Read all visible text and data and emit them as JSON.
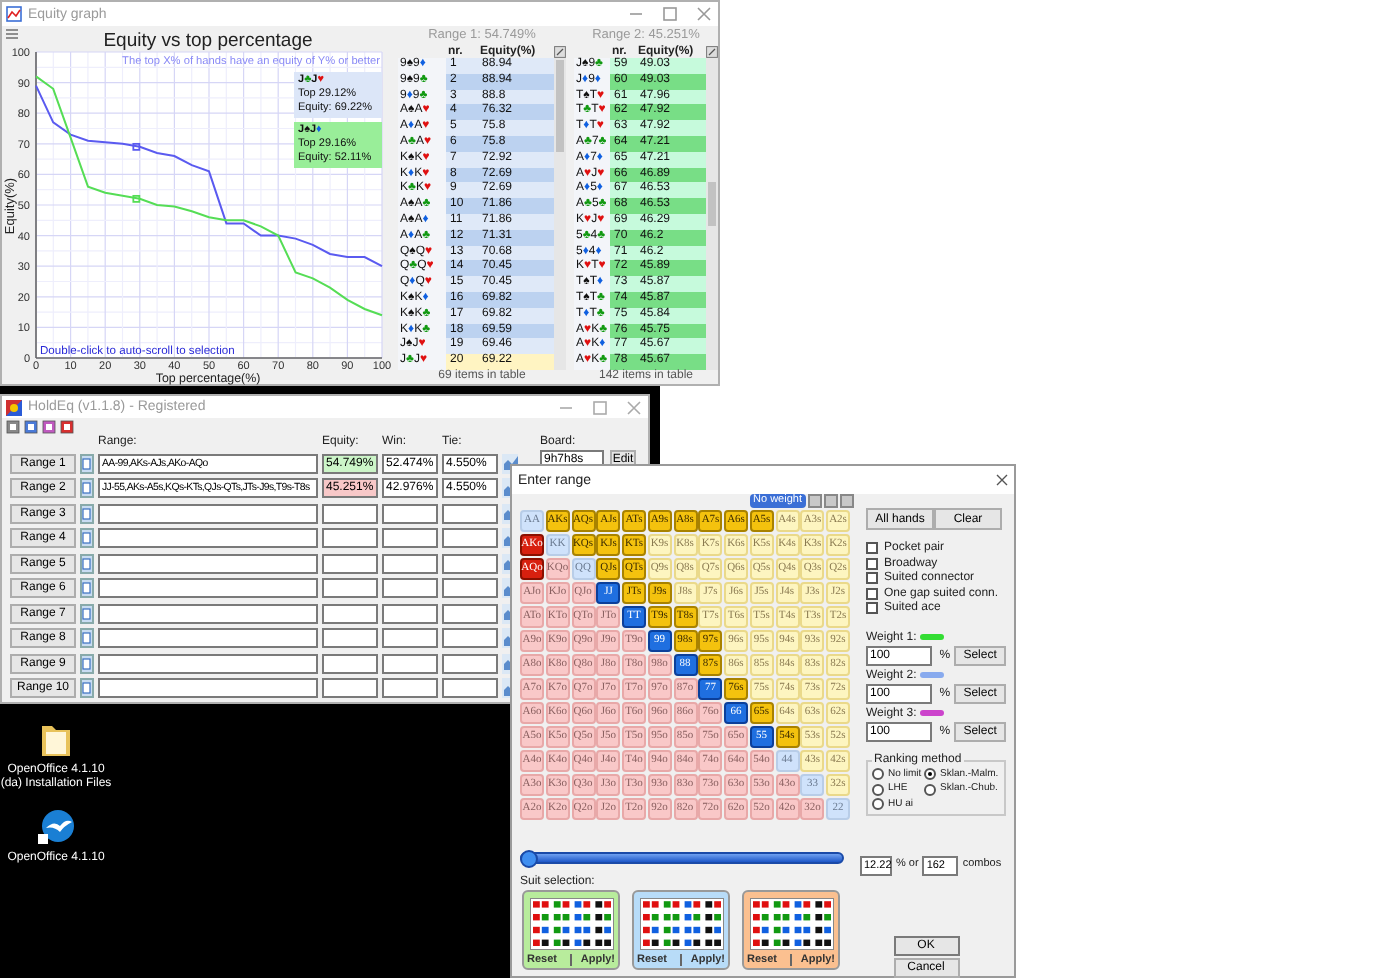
{
  "equity_graph": {
    "title": "Equity graph",
    "subtitle": "The top X% of hands have an equity of Y% or better",
    "hint": "Double-click to auto-scroll to selection",
    "chart_data": {
      "type": "line",
      "title": "Equity vs top percentage",
      "xlabel": "Top percentage(%)",
      "ylabel": "Equity(%)",
      "x": [
        0,
        5,
        10,
        15,
        20,
        25,
        30,
        35,
        40,
        45,
        50,
        55,
        60,
        65,
        70,
        75,
        80,
        85,
        90,
        95,
        100
      ],
      "grid": true,
      "series": [
        {
          "color": "#5a5af0",
          "values": [
            89,
            77,
            73,
            71,
            70.5,
            70,
            69,
            67,
            66,
            63,
            61,
            44,
            44,
            40,
            40,
            39,
            37,
            34,
            33,
            33,
            30
          ]
        },
        {
          "color": "#55dd55",
          "values": [
            92,
            88,
            72,
            56,
            54,
            53,
            52,
            50,
            49.5,
            48,
            46,
            45,
            45,
            43,
            40,
            28,
            26,
            23,
            19,
            16,
            14
          ]
        }
      ],
      "xlim": [
        0,
        100
      ],
      "ylim": [
        0,
        100
      ],
      "xticks": [
        0,
        10,
        20,
        30,
        40,
        50,
        60,
        70,
        80,
        90,
        100
      ],
      "yticks": [
        0,
        10,
        20,
        30,
        40,
        50,
        60,
        70,
        80,
        90,
        100
      ]
    },
    "highlights": [
      {
        "hand": "J♣J♥",
        "top": "Top 29.12%",
        "equity": "Equity: 69.22%",
        "color": "#dce6f8"
      },
      {
        "hand": "J♠J♦",
        "top": "Top 29.16%",
        "equity": "Equity: 52.11%",
        "color": "#99ee99"
      }
    ],
    "tables": [
      {
        "title": "Range 1: 54.749%",
        "columns": [
          "nr.",
          "Equity(%)"
        ],
        "footer": "69 items in table",
        "rows": [
          {
            "hand": "9♠9♦",
            "nr": "1",
            "equity": "88.94",
            "selected": false
          },
          {
            "hand": "9♠9♣",
            "nr": "2",
            "equity": "88.94",
            "selected": false
          },
          {
            "hand": "9♦9♣",
            "nr": "3",
            "equity": "88.8",
            "selected": false
          },
          {
            "hand": "A♠A♥",
            "nr": "4",
            "equity": "76.32",
            "selected": false
          },
          {
            "hand": "A♦A♥",
            "nr": "5",
            "equity": "75.8",
            "selected": false
          },
          {
            "hand": "A♣A♥",
            "nr": "6",
            "equity": "75.8",
            "selected": false
          },
          {
            "hand": "K♠K♥",
            "nr": "7",
            "equity": "72.92",
            "selected": false
          },
          {
            "hand": "K♦K♥",
            "nr": "8",
            "equity": "72.69",
            "selected": false
          },
          {
            "hand": "K♣K♥",
            "nr": "9",
            "equity": "72.69",
            "selected": false
          },
          {
            "hand": "A♠A♣",
            "nr": "10",
            "equity": "71.86",
            "selected": false
          },
          {
            "hand": "A♠A♦",
            "nr": "11",
            "equity": "71.86",
            "selected": false
          },
          {
            "hand": "A♦A♣",
            "nr": "12",
            "equity": "71.31",
            "selected": false
          },
          {
            "hand": "Q♠Q♥",
            "nr": "13",
            "equity": "70.68",
            "selected": false
          },
          {
            "hand": "Q♣Q♥",
            "nr": "14",
            "equity": "70.45",
            "selected": false
          },
          {
            "hand": "Q♦Q♥",
            "nr": "15",
            "equity": "70.45",
            "selected": false
          },
          {
            "hand": "K♠K♦",
            "nr": "16",
            "equity": "69.82",
            "selected": false
          },
          {
            "hand": "K♠K♣",
            "nr": "17",
            "equity": "69.82",
            "selected": false
          },
          {
            "hand": "K♦K♣",
            "nr": "18",
            "equity": "69.59",
            "selected": false
          },
          {
            "hand": "J♠J♥",
            "nr": "19",
            "equity": "69.46",
            "selected": false
          },
          {
            "hand": "J♣J♥",
            "nr": "20",
            "equity": "69.22",
            "selected": true
          }
        ]
      },
      {
        "title": "Range 2: 45.251%",
        "columns": [
          "nr.",
          "Equity(%)"
        ],
        "footer": "142 items in table",
        "rows": [
          {
            "hand": "J♠9♣",
            "nr": "59",
            "equity": "49.03",
            "selected": false
          },
          {
            "hand": "J♦9♦",
            "nr": "60",
            "equity": "49.03",
            "selected": false
          },
          {
            "hand": "T♠T♥",
            "nr": "61",
            "equity": "47.96",
            "selected": false
          },
          {
            "hand": "T♣T♥",
            "nr": "62",
            "equity": "47.92",
            "selected": false
          },
          {
            "hand": "T♦T♥",
            "nr": "63",
            "equity": "47.92",
            "selected": false
          },
          {
            "hand": "A♣7♣",
            "nr": "64",
            "equity": "47.21",
            "selected": false
          },
          {
            "hand": "A♦7♦",
            "nr": "65",
            "equity": "47.21",
            "selected": false
          },
          {
            "hand": "A♥J♥",
            "nr": "66",
            "equity": "46.89",
            "selected": false
          },
          {
            "hand": "A♦5♦",
            "nr": "67",
            "equity": "46.53",
            "selected": false
          },
          {
            "hand": "A♣5♣",
            "nr": "68",
            "equity": "46.53",
            "selected": false
          },
          {
            "hand": "K♥J♥",
            "nr": "69",
            "equity": "46.29",
            "selected": false
          },
          {
            "hand": "5♣4♣",
            "nr": "70",
            "equity": "46.2",
            "selected": false
          },
          {
            "hand": "5♦4♦",
            "nr": "71",
            "equity": "46.2",
            "selected": false
          },
          {
            "hand": "K♥T♥",
            "nr": "72",
            "equity": "45.89",
            "selected": false
          },
          {
            "hand": "T♠T♦",
            "nr": "73",
            "equity": "45.87",
            "selected": false
          },
          {
            "hand": "T♠T♣",
            "nr": "74",
            "equity": "45.87",
            "selected": false
          },
          {
            "hand": "T♦T♣",
            "nr": "75",
            "equity": "45.84",
            "selected": false
          },
          {
            "hand": "A♥K♣",
            "nr": "76",
            "equity": "45.75",
            "selected": false
          },
          {
            "hand": "A♥K♦",
            "nr": "77",
            "equity": "45.67",
            "selected": false
          },
          {
            "hand": "A♥K♣",
            "nr": "78",
            "equity": "45.67",
            "selected": false
          }
        ]
      }
    ]
  },
  "holdeq": {
    "title": "HoldEq (v1.1.8) - Registered",
    "columns": [
      "Range:",
      "Equity:",
      "Win:",
      "Tie:"
    ],
    "board_label": "Board:",
    "board": "9h7h8s",
    "edit": "Edit",
    "ranges": [
      {
        "label": "Range 1",
        "range": "AA-99,AKs-AJs,AKo-AQo",
        "equity": "54.749%",
        "win": "52.474%",
        "tie": "4.550%",
        "color": "#ccf5c8"
      },
      {
        "label": "Range 2",
        "range": "JJ-55,AKs-A5s,KQs-KTs,QJs-QTs,JTs-J9s,T9s-T8s",
        "equity": "45.251%",
        "win": "42.976%",
        "tie": "4.550%",
        "color": "#f8c8c8"
      },
      {
        "label": "Range 3"
      },
      {
        "label": "Range 4"
      },
      {
        "label": "Range 5"
      },
      {
        "label": "Range 6"
      },
      {
        "label": "Range 7"
      },
      {
        "label": "Range 8"
      },
      {
        "label": "Range 9"
      },
      {
        "label": "Range 10"
      }
    ]
  },
  "enter_range": {
    "title": "Enter range",
    "weight_badge": "No weight",
    "hand_grid": [
      [
        {
          "label": "AA",
          "selected": false
        },
        {
          "label": "AKs",
          "selected": true
        },
        {
          "label": "AQs",
          "selected": true
        },
        {
          "label": "AJs",
          "selected": true
        },
        {
          "label": "ATs",
          "selected": true
        },
        {
          "label": "A9s",
          "selected": true
        },
        {
          "label": "A8s",
          "selected": true
        },
        {
          "label": "A7s",
          "selected": true
        },
        {
          "label": "A6s",
          "selected": true
        },
        {
          "label": "A5s",
          "selected": true
        },
        {
          "label": "A4s",
          "selected": false
        },
        {
          "label": "A3s",
          "selected": false
        },
        {
          "label": "A2s",
          "selected": false
        }
      ],
      [
        {
          "label": "AKo",
          "selected": true
        },
        {
          "label": "KK",
          "selected": false
        },
        {
          "label": "KQs",
          "selected": true
        },
        {
          "label": "KJs",
          "selected": true
        },
        {
          "label": "KTs",
          "selected": true
        },
        {
          "label": "K9s",
          "selected": false
        },
        {
          "label": "K8s",
          "selected": false
        },
        {
          "label": "K7s",
          "selected": false
        },
        {
          "label": "K6s",
          "selected": false
        },
        {
          "label": "K5s",
          "selected": false
        },
        {
          "label": "K4s",
          "selected": false
        },
        {
          "label": "K3s",
          "selected": false
        },
        {
          "label": "K2s",
          "selected": false
        }
      ],
      [
        {
          "label": "AQo",
          "selected": true
        },
        {
          "label": "KQo",
          "selected": false
        },
        {
          "label": "QQ",
          "selected": false
        },
        {
          "label": "QJs",
          "selected": true
        },
        {
          "label": "QTs",
          "selected": true
        },
        {
          "label": "Q9s",
          "selected": false
        },
        {
          "label": "Q8s",
          "selected": false
        },
        {
          "label": "Q7s",
          "selected": false
        },
        {
          "label": "Q6s",
          "selected": false
        },
        {
          "label": "Q5s",
          "selected": false
        },
        {
          "label": "Q4s",
          "selected": false
        },
        {
          "label": "Q3s",
          "selected": false
        },
        {
          "label": "Q2s",
          "selected": false
        }
      ],
      [
        {
          "label": "AJo",
          "selected": false
        },
        {
          "label": "KJo",
          "selected": false
        },
        {
          "label": "QJo",
          "selected": false
        },
        {
          "label": "JJ",
          "selected": true
        },
        {
          "label": "JTs",
          "selected": true
        },
        {
          "label": "J9s",
          "selected": true
        },
        {
          "label": "J8s",
          "selected": false
        },
        {
          "label": "J7s",
          "selected": false
        },
        {
          "label": "J6s",
          "selected": false
        },
        {
          "label": "J5s",
          "selected": false
        },
        {
          "label": "J4s",
          "selected": false
        },
        {
          "label": "J3s",
          "selected": false
        },
        {
          "label": "J2s",
          "selected": false
        }
      ],
      [
        {
          "label": "ATo",
          "selected": false
        },
        {
          "label": "KTo",
          "selected": false
        },
        {
          "label": "QTo",
          "selected": false
        },
        {
          "label": "JTo",
          "selected": false
        },
        {
          "label": "TT",
          "selected": true
        },
        {
          "label": "T9s",
          "selected": true
        },
        {
          "label": "T8s",
          "selected": true
        },
        {
          "label": "T7s",
          "selected": false
        },
        {
          "label": "T6s",
          "selected": false
        },
        {
          "label": "T5s",
          "selected": false
        },
        {
          "label": "T4s",
          "selected": false
        },
        {
          "label": "T3s",
          "selected": false
        },
        {
          "label": "T2s",
          "selected": false
        }
      ],
      [
        {
          "label": "A9o",
          "selected": false
        },
        {
          "label": "K9o",
          "selected": false
        },
        {
          "label": "Q9o",
          "selected": false
        },
        {
          "label": "J9o",
          "selected": false
        },
        {
          "label": "T9o",
          "selected": false
        },
        {
          "label": "99",
          "selected": true
        },
        {
          "label": "98s",
          "selected": true
        },
        {
          "label": "97s",
          "selected": true
        },
        {
          "label": "96s",
          "selected": false
        },
        {
          "label": "95s",
          "selected": false
        },
        {
          "label": "94s",
          "selected": false
        },
        {
          "label": "93s",
          "selected": false
        },
        {
          "label": "92s",
          "selected": false
        }
      ],
      [
        {
          "label": "A8o",
          "selected": false
        },
        {
          "label": "K8o",
          "selected": false
        },
        {
          "label": "Q8o",
          "selected": false
        },
        {
          "label": "J8o",
          "selected": false
        },
        {
          "label": "T8o",
          "selected": false
        },
        {
          "label": "98o",
          "selected": false
        },
        {
          "label": "88",
          "selected": true
        },
        {
          "label": "87s",
          "selected": true
        },
        {
          "label": "86s",
          "selected": false
        },
        {
          "label": "85s",
          "selected": false
        },
        {
          "label": "84s",
          "selected": false
        },
        {
          "label": "83s",
          "selected": false
        },
        {
          "label": "82s",
          "selected": false
        }
      ],
      [
        {
          "label": "A7o",
          "selected": false
        },
        {
          "label": "K7o",
          "selected": false
        },
        {
          "label": "Q7o",
          "selected": false
        },
        {
          "label": "J7o",
          "selected": false
        },
        {
          "label": "T7o",
          "selected": false
        },
        {
          "label": "97o",
          "selected": false
        },
        {
          "label": "87o",
          "selected": false
        },
        {
          "label": "77",
          "selected": true
        },
        {
          "label": "76s",
          "selected": true
        },
        {
          "label": "75s",
          "selected": false
        },
        {
          "label": "74s",
          "selected": false
        },
        {
          "label": "73s",
          "selected": false
        },
        {
          "label": "72s",
          "selected": false
        }
      ],
      [
        {
          "label": "A6o",
          "selected": false
        },
        {
          "label": "K6o",
          "selected": false
        },
        {
          "label": "Q6o",
          "selected": false
        },
        {
          "label": "J6o",
          "selected": false
        },
        {
          "label": "T6o",
          "selected": false
        },
        {
          "label": "96o",
          "selected": false
        },
        {
          "label": "86o",
          "selected": false
        },
        {
          "label": "76o",
          "selected": false
        },
        {
          "label": "66",
          "selected": true
        },
        {
          "label": "65s",
          "selected": true
        },
        {
          "label": "64s",
          "selected": false
        },
        {
          "label": "63s",
          "selected": false
        },
        {
          "label": "62s",
          "selected": false
        }
      ],
      [
        {
          "label": "A5o",
          "selected": false
        },
        {
          "label": "K5o",
          "selected": false
        },
        {
          "label": "Q5o",
          "selected": false
        },
        {
          "label": "J5o",
          "selected": false
        },
        {
          "label": "T5o",
          "selected": false
        },
        {
          "label": "95o",
          "selected": false
        },
        {
          "label": "85o",
          "selected": false
        },
        {
          "label": "75o",
          "selected": false
        },
        {
          "label": "65o",
          "selected": false
        },
        {
          "label": "55",
          "selected": true
        },
        {
          "label": "54s",
          "selected": true
        },
        {
          "label": "53s",
          "selected": false
        },
        {
          "label": "52s",
          "selected": false
        }
      ],
      [
        {
          "label": "A4o",
          "selected": false
        },
        {
          "label": "K4o",
          "selected": false
        },
        {
          "label": "Q4o",
          "selected": false
        },
        {
          "label": "J4o",
          "selected": false
        },
        {
          "label": "T4o",
          "selected": false
        },
        {
          "label": "94o",
          "selected": false
        },
        {
          "label": "84o",
          "selected": false
        },
        {
          "label": "74o",
          "selected": false
        },
        {
          "label": "64o",
          "selected": false
        },
        {
          "label": "54o",
          "selected": false
        },
        {
          "label": "44",
          "selected": false
        },
        {
          "label": "43s",
          "selected": false
        },
        {
          "label": "42s",
          "selected": false
        }
      ],
      [
        {
          "label": "A3o",
          "selected": false
        },
        {
          "label": "K3o",
          "selected": false
        },
        {
          "label": "Q3o",
          "selected": false
        },
        {
          "label": "J3o",
          "selected": false
        },
        {
          "label": "T3o",
          "selected": false
        },
        {
          "label": "93o",
          "selected": false
        },
        {
          "label": "83o",
          "selected": false
        },
        {
          "label": "73o",
          "selected": false
        },
        {
          "label": "63o",
          "selected": false
        },
        {
          "label": "53o",
          "selected": false
        },
        {
          "label": "43o",
          "selected": false
        },
        {
          "label": "33",
          "selected": false
        },
        {
          "label": "32s",
          "selected": false
        }
      ],
      [
        {
          "label": "A2o",
          "selected": false
        },
        {
          "label": "K2o",
          "selected": false
        },
        {
          "label": "Q2o",
          "selected": false
        },
        {
          "label": "J2o",
          "selected": false
        },
        {
          "label": "T2o",
          "selected": false
        },
        {
          "label": "92o",
          "selected": false
        },
        {
          "label": "82o",
          "selected": false
        },
        {
          "label": "72o",
          "selected": false
        },
        {
          "label": "62o",
          "selected": false
        },
        {
          "label": "52o",
          "selected": false
        },
        {
          "label": "42o",
          "selected": false
        },
        {
          "label": "32o",
          "selected": false
        },
        {
          "label": "22",
          "selected": false
        }
      ]
    ],
    "buttons": [
      "All hands",
      "Clear"
    ],
    "filters": [
      {
        "label": "Pocket pair",
        "checked": false
      },
      {
        "label": "Broadway",
        "checked": false
      },
      {
        "label": "Suited connector",
        "checked": false
      },
      {
        "label": "One gap suited conn.",
        "checked": false
      },
      {
        "label": "Suited ace",
        "checked": false
      }
    ],
    "weights": [
      {
        "label": "Weight 1:",
        "color": "#33dd33",
        "value": "100",
        "unit": "%",
        "button": "Select"
      },
      {
        "label": "Weight 2:",
        "color": "#88aaee",
        "value": "100",
        "unit": "%",
        "button": "Select"
      },
      {
        "label": "Weight 3:",
        "color": "#cc44cc",
        "value": "100",
        "unit": "%",
        "button": "Select"
      }
    ],
    "ranking": {
      "title": "Ranking method",
      "options": [
        {
          "label": "No limit",
          "selected": false
        },
        {
          "label": "Sklan.-Malm.",
          "selected": true
        },
        {
          "label": "LHE",
          "selected": false
        },
        {
          "label": "Sklan.-Chub.",
          "selected": false
        },
        {
          "label": "HU ai",
          "selected": false
        }
      ]
    },
    "slider": {
      "level": 0.0
    },
    "percent": "12.22",
    "percent_unit": "% or",
    "combos": "162",
    "combos_unit": "combos",
    "suit_selection": {
      "label": "Suit selection:",
      "panels": [
        {
          "color": "#b8ec9c",
          "reset": "Reset",
          "apply": "Apply!"
        },
        {
          "color": "#b8dcf8",
          "reset": "Reset",
          "apply": "Apply!"
        },
        {
          "color": "#fbc090",
          "reset": "Reset",
          "apply": "Apply!"
        }
      ]
    },
    "ok": "OK",
    "cancel": "Cancel"
  },
  "desktop_icons": [
    {
      "kind": "folder",
      "label": "OpenOffice 4.1.10\n(da) Installation Files"
    },
    {
      "kind": "app",
      "label": "OpenOffice 4.1.10"
    }
  ]
}
